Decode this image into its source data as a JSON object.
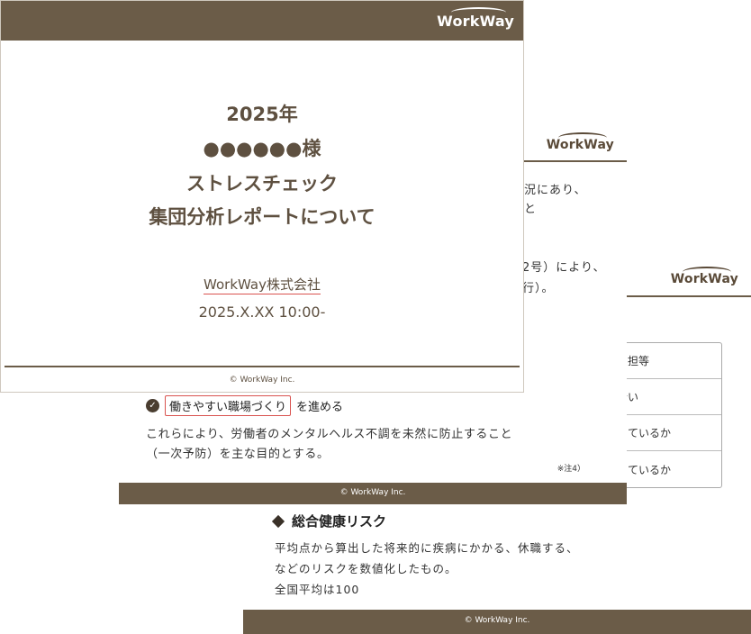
{
  "slide_title": {
    "logo": "WorkWay",
    "year": "2025年",
    "client": "●●●●●●様",
    "line1": "ストレスチェック",
    "line2": "集団分析レポートについて",
    "company": "WorkWay株式会社",
    "datetime": "2025.X.XX 10:00-",
    "footer": "© WorkWay Inc."
  },
  "slide_middle": {
    "logo": "WorkWay",
    "frag1": "状況にあり、",
    "frag2": "題と",
    "frag3": "2号）により、",
    "frag4": "行）。",
    "check_highlight": "働きやすい職場づくり",
    "check_rest": "を進める",
    "body1": "これらにより、労働者のメンタルヘルス不調を未然に防止すること",
    "body2": "（一次予防）を主な目的とする。",
    "note": "※注4）",
    "footer": "© WorkWay Inc."
  },
  "slide_back": {
    "logo": "WorkWay",
    "table_rows": [
      "ない負担等",
      "る度合い",
      "と感じているか",
      "と感じているか"
    ],
    "section_title": "総合健康リスク",
    "para1": "平均点から算出した将来的に疾病にかかる、休職する、",
    "para2": "などのリスクを数値化したもの。",
    "para3": "全国平均は100",
    "footer": "© WorkWay Inc."
  },
  "colors": {
    "brand_brown": "#6b5c48",
    "highlight_red": "#d9534f"
  }
}
